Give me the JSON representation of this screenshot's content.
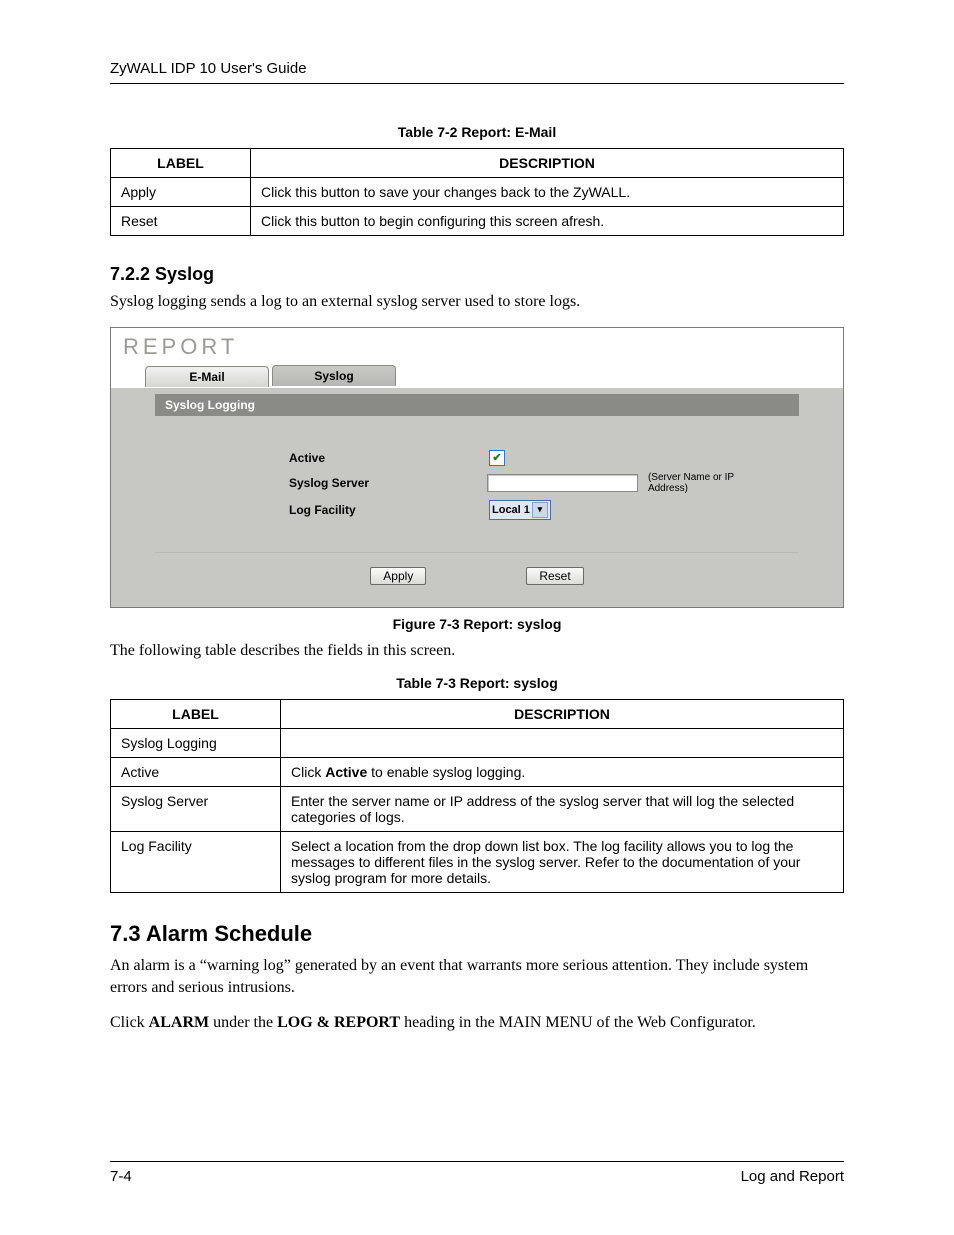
{
  "running_head": "ZyWALL IDP 10 User's Guide",
  "table72": {
    "caption": "Table 7-2 Report: E-Mail",
    "head_label": "LABEL",
    "head_desc": "DESCRIPTION",
    "rows": [
      {
        "label": "Apply",
        "desc": "Click this button to save your changes back to the ZyWALL."
      },
      {
        "label": "Reset",
        "desc": "Click this button to begin configuring this screen afresh."
      }
    ]
  },
  "sec722": {
    "heading": "7.2.2  Syslog",
    "para": "Syslog logging sends a log to an external syslog server used to store logs."
  },
  "shot": {
    "title": "REPORT",
    "tab_email": "E-Mail",
    "tab_syslog": "Syslog",
    "panel_title": "Syslog Logging",
    "lbl_active": "Active",
    "lbl_server": "Syslog Server",
    "hint_server": "(Server Name or IP Address)",
    "lbl_facility": "Log Facility",
    "facility_value": "Local 1",
    "btn_apply": "Apply",
    "btn_reset": "Reset"
  },
  "fig73_caption": "Figure 7-3 Report: syslog",
  "after_fig_p": "The following table describes the fields in this screen.",
  "table73": {
    "caption": "Table 7-3 Report: syslog",
    "head_label": "LABEL",
    "head_desc": "DESCRIPTION",
    "rows": [
      {
        "label": "Syslog Logging",
        "desc": ""
      },
      {
        "label": "Active",
        "desc_pre": "Click ",
        "desc_bold": "Active",
        "desc_post": " to enable syslog logging."
      },
      {
        "label": "Syslog Server",
        "desc": "Enter the server name or IP address of the syslog server that will log the selected categories of logs."
      },
      {
        "label": "Log Facility",
        "desc": "Select a location from the drop down list box. The log facility allows you to log the messages to different files in the syslog server. Refer to the documentation of your syslog program for more details."
      }
    ]
  },
  "sec73": {
    "heading": "7.3    Alarm Schedule",
    "p1": "An alarm is a “warning log” generated by an event that warrants more serious attention. They include system errors and serious intrusions.",
    "p2_pre": "Click ",
    "p2_b1": "ALARM",
    "p2_mid": " under the ",
    "p2_b2": "LOG & REPORT",
    "p2_post": " heading in the MAIN MENU of the Web Configurator."
  },
  "footer": {
    "left": "7-4",
    "right": "Log and Report"
  },
  "chart_data": {
    "type": "table",
    "tables": [
      {
        "title": "Table 7-2 Report: E-Mail",
        "columns": [
          "LABEL",
          "DESCRIPTION"
        ],
        "rows": [
          [
            "Apply",
            "Click this button to save your changes back to the ZyWALL."
          ],
          [
            "Reset",
            "Click this button to begin configuring this screen afresh."
          ]
        ]
      },
      {
        "title": "Table 7-3 Report: syslog",
        "columns": [
          "LABEL",
          "DESCRIPTION"
        ],
        "rows": [
          [
            "Syslog Logging",
            ""
          ],
          [
            "Active",
            "Click Active to enable syslog logging."
          ],
          [
            "Syslog Server",
            "Enter the server name or IP address of the syslog server that will log the selected categories of logs."
          ],
          [
            "Log Facility",
            "Select a location from the drop down list box. The log facility allows you to log the messages to different files in the syslog server. Refer to the documentation of your syslog program for more details."
          ]
        ]
      }
    ]
  }
}
